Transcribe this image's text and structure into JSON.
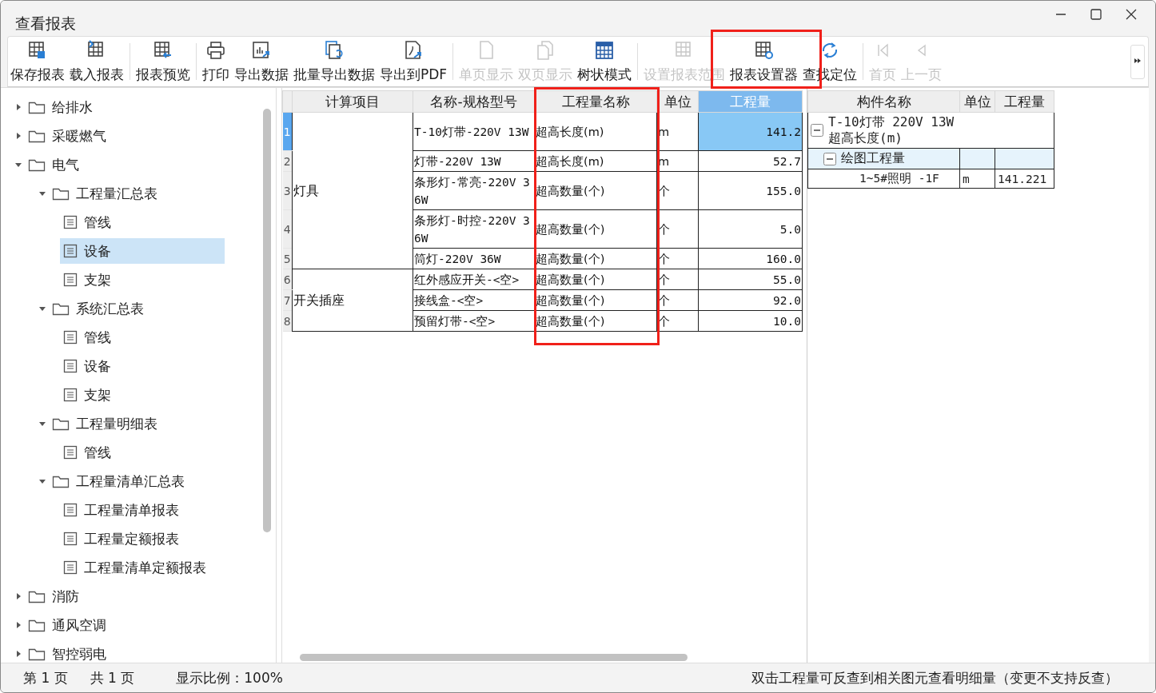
{
  "window": {
    "title": "查看报表"
  },
  "toolbar": {
    "groups": [
      [
        {
          "label": "保存报表",
          "disabled": false,
          "highlighted": false
        },
        {
          "label": "载入报表",
          "disabled": false,
          "highlighted": false
        }
      ],
      [
        {
          "label": "报表预览",
          "disabled": false,
          "highlighted": false
        }
      ],
      [
        {
          "label": "打印",
          "disabled": false,
          "highlighted": false
        },
        {
          "label": "导出数据",
          "disabled": false,
          "highlighted": false
        },
        {
          "label": "批量导出数据",
          "disabled": false,
          "highlighted": false
        },
        {
          "label": "导出到PDF",
          "disabled": false,
          "highlighted": false
        }
      ],
      [
        {
          "label": "单页显示",
          "disabled": true,
          "highlighted": false
        },
        {
          "label": "双页显示",
          "disabled": true,
          "highlighted": false
        },
        {
          "label": "树状模式",
          "disabled": false,
          "highlighted": false
        }
      ],
      [
        {
          "label": "设置报表范围",
          "disabled": true,
          "highlighted": false
        },
        {
          "label": "报表设置器",
          "disabled": false,
          "highlighted": true
        },
        {
          "label": "查找定位",
          "disabled": false,
          "highlighted": false
        }
      ],
      [
        {
          "label": "首页",
          "disabled": true,
          "highlighted": false
        },
        {
          "label": "上一页",
          "disabled": true,
          "highlighted": false
        }
      ]
    ]
  },
  "tree": [
    {
      "label": "给排水",
      "kind": "folder",
      "expanded": false,
      "selected": false
    },
    {
      "label": "采暖燃气",
      "kind": "folder",
      "expanded": false,
      "selected": false
    },
    {
      "label": "电气",
      "kind": "folder",
      "expanded": true,
      "selected": false,
      "children": [
        {
          "label": "工程量汇总表",
          "kind": "folder",
          "expanded": true,
          "selected": false,
          "children": [
            {
              "label": "管线",
              "kind": "sheet",
              "selected": false
            },
            {
              "label": "设备",
              "kind": "sheet",
              "selected": true
            },
            {
              "label": "支架",
              "kind": "sheet",
              "selected": false
            }
          ]
        },
        {
          "label": "系统汇总表",
          "kind": "folder",
          "expanded": true,
          "selected": false,
          "children": [
            {
              "label": "管线",
              "kind": "sheet",
              "selected": false
            },
            {
              "label": "设备",
              "kind": "sheet",
              "selected": false
            },
            {
              "label": "支架",
              "kind": "sheet",
              "selected": false
            }
          ]
        },
        {
          "label": "工程量明细表",
          "kind": "folder",
          "expanded": true,
          "selected": false,
          "children": [
            {
              "label": "管线",
              "kind": "sheet",
              "selected": false
            }
          ]
        },
        {
          "label": "工程量清单汇总表",
          "kind": "folder",
          "expanded": true,
          "selected": false,
          "children": [
            {
              "label": "工程量清单报表",
              "kind": "sheet",
              "selected": false
            },
            {
              "label": "工程量定额报表",
              "kind": "sheet",
              "selected": false
            },
            {
              "label": "工程量清单定额报表",
              "kind": "sheet",
              "selected": false
            }
          ]
        }
      ]
    },
    {
      "label": "消防",
      "kind": "folder",
      "expanded": false,
      "selected": false
    },
    {
      "label": "通风空调",
      "kind": "folder",
      "expanded": false,
      "selected": false
    },
    {
      "label": "智控弱电",
      "kind": "folder",
      "expanded": false,
      "selected": false
    }
  ],
  "table": {
    "columns": [
      {
        "label": "计算项目",
        "selected": false,
        "highlighted": false
      },
      {
        "label": "名称-规格型号",
        "selected": false,
        "highlighted": false
      },
      {
        "label": "工程量名称",
        "selected": false,
        "highlighted": true
      },
      {
        "label": "单位",
        "selected": false,
        "highlighted": false
      },
      {
        "label": "工程量",
        "selected": true,
        "highlighted": false
      }
    ],
    "groups": [
      {
        "item": "灯具",
        "rows": [
          {
            "number": "1",
            "name": "T-10灯带-220V 13W",
            "quantity_name": "超高长度(m)",
            "unit": "m",
            "value": "141.2",
            "selected": true
          },
          {
            "number": "2",
            "name": "灯带-220V 13W",
            "quantity_name": "超高长度(m)",
            "unit": "m",
            "value": "52.7",
            "selected": false
          },
          {
            "number": "3",
            "name": "条形灯-常亮-220V 36W",
            "quantity_name": "超高数量(个)",
            "unit": "个",
            "value": "155.0",
            "selected": false
          },
          {
            "number": "4",
            "name": "条形灯-时控-220V 36W",
            "quantity_name": "超高数量(个)",
            "unit": "个",
            "value": "5.0",
            "selected": false
          },
          {
            "number": "5",
            "name": "筒灯-220V 36W",
            "quantity_name": "超高数量(个)",
            "unit": "个",
            "value": "160.0",
            "selected": false
          }
        ]
      },
      {
        "item": "开关插座",
        "rows": [
          {
            "number": "6",
            "name": "红外感应开关-<空>",
            "quantity_name": "超高数量(个)",
            "unit": "个",
            "value": "55.0",
            "selected": false
          },
          {
            "number": "7",
            "name": "接线盒-<空>",
            "quantity_name": "超高数量(个)",
            "unit": "个",
            "value": "92.0",
            "selected": false
          },
          {
            "number": "8",
            "name": "预留灯带-<空>",
            "quantity_name": "超高数量(个)",
            "unit": "个",
            "value": "10.0",
            "selected": false
          }
        ]
      }
    ]
  },
  "detail": {
    "columns": [
      "构件名称",
      "单位",
      "工程量"
    ],
    "rows": [
      {
        "kind": "header",
        "lines": [
          "T-10灯带 220V 13W",
          "超高长度(m)"
        ],
        "expanded": true,
        "children": [
          {
            "kind": "group",
            "label": "绘图工程量",
            "expanded": true,
            "children": [
              {
                "kind": "item",
                "label": "1~5#照明 -1F",
                "unit": "m",
                "quantity": "141.221"
              }
            ]
          }
        ]
      }
    ]
  },
  "status_bar": {
    "page": "第 1 页",
    "total": "共 1 页",
    "zoom": "显示比例：100%",
    "hint": "双击工程量可反查到相关图元查看明细量（变更不支持反查）"
  }
}
